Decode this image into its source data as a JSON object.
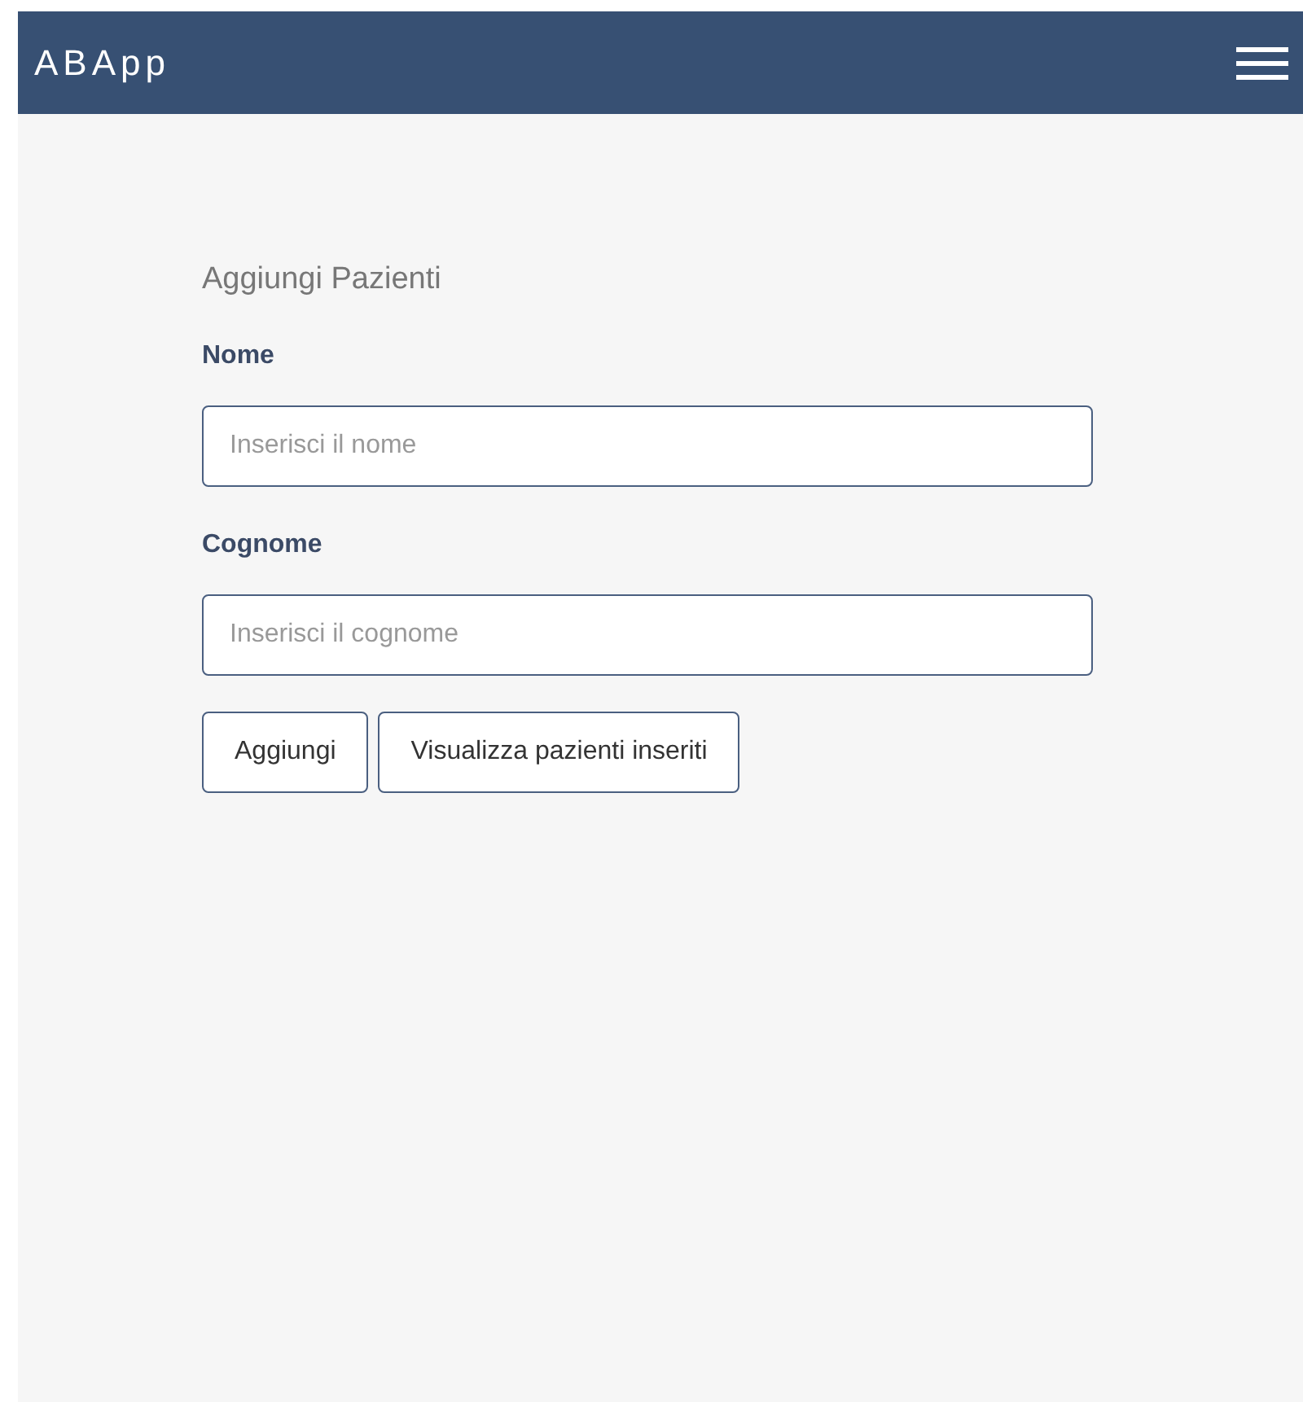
{
  "navbar": {
    "brand": "ABApp"
  },
  "form": {
    "title": "Aggiungi Pazienti",
    "fields": [
      {
        "label": "Nome",
        "placeholder": "Inserisci il nome"
      },
      {
        "label": "Cognome",
        "placeholder": "Inserisci il cognome"
      }
    ],
    "buttons": [
      "Aggiungi",
      "Visualizza pazienti inseriti"
    ]
  }
}
